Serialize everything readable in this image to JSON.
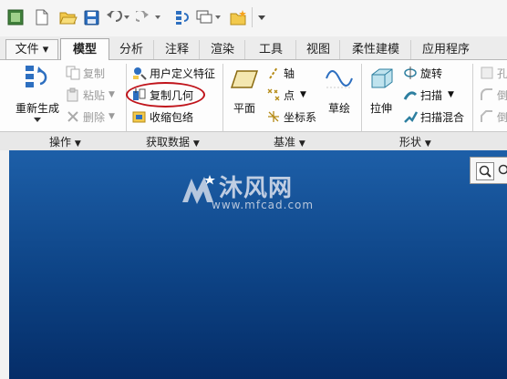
{
  "tabs": [
    {
      "label": "文件 ▾",
      "active": false
    },
    {
      "label": "模型",
      "active": true
    },
    {
      "label": "分析",
      "active": false
    },
    {
      "label": "注释",
      "active": false
    },
    {
      "label": "渲染",
      "active": false
    },
    {
      "label": "工具",
      "active": false
    },
    {
      "label": "视图",
      "active": false
    },
    {
      "label": "柔性建模",
      "active": false
    },
    {
      "label": "应用程序",
      "active": false
    }
  ],
  "operations": {
    "regenerate": "重新生成",
    "copy": "复制",
    "paste": "粘贴",
    "delete": "删除",
    "group": "操作"
  },
  "get_data": {
    "udf": "用户定义特征",
    "copy_geometry": "复制几何",
    "shrinkwrap": "收缩包络",
    "group": "获取数据"
  },
  "datum": {
    "plane": "平面",
    "axis": "轴",
    "point": "点",
    "csys": "坐标系",
    "sketch": "草绘",
    "group": "基准"
  },
  "shapes": {
    "extrude": "拉伸",
    "revolve": "旋转",
    "sweep": "扫描",
    "swept_blend": "扫描混合",
    "group": "形状"
  },
  "clipped": {
    "hole": "孔",
    "round": "倒",
    "chamfer": "倒"
  },
  "watermark": {
    "brand": "沐风网",
    "url": "www.mfcad.com"
  },
  "colors": {
    "accent_red": "#c0141b",
    "workspace": "#0d4385"
  }
}
